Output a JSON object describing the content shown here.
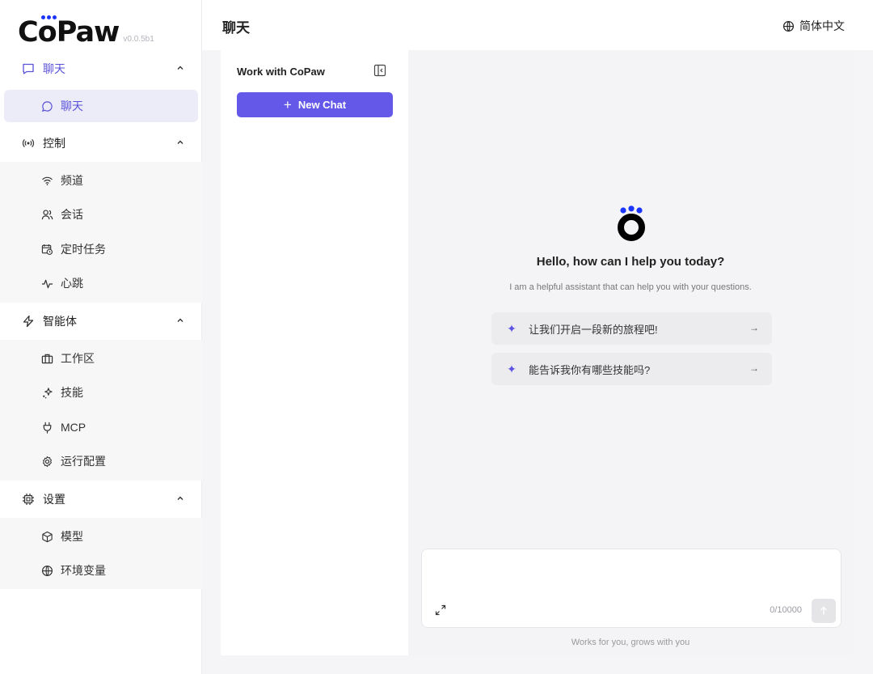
{
  "app": {
    "logo": "CoPaw",
    "version": "v0.0.5b1",
    "accent": "#6358e8",
    "logo_dot_color": "#1a35ff"
  },
  "sidebar": {
    "groups": [
      {
        "label": "聊天",
        "icon": "message-icon",
        "expanded": true,
        "items": [
          {
            "label": "聊天",
            "icon": "chat-bubble-icon",
            "active": true
          }
        ]
      },
      {
        "label": "控制",
        "icon": "broadcast-icon",
        "expanded": true,
        "items": [
          {
            "label": "频道",
            "icon": "wifi-icon"
          },
          {
            "label": "会话",
            "icon": "users-icon"
          },
          {
            "label": "定时任务",
            "icon": "calendar-clock-icon"
          },
          {
            "label": "心跳",
            "icon": "pulse-icon"
          }
        ]
      },
      {
        "label": "智能体",
        "icon": "lightning-icon",
        "expanded": true,
        "items": [
          {
            "label": "工作区",
            "icon": "briefcase-icon"
          },
          {
            "label": "技能",
            "icon": "sparkles-icon"
          },
          {
            "label": "MCP",
            "icon": "plug-icon"
          },
          {
            "label": "运行配置",
            "icon": "gear-icon"
          }
        ]
      },
      {
        "label": "设置",
        "icon": "chip-icon",
        "expanded": true,
        "items": [
          {
            "label": "模型",
            "icon": "cube-icon"
          },
          {
            "label": "环境变量",
            "icon": "globe-icon"
          }
        ]
      }
    ]
  },
  "header": {
    "title": "聊天",
    "language": "简体中文"
  },
  "sessions": {
    "title": "Work with CoPaw",
    "new_chat_label": "New Chat"
  },
  "chat": {
    "greeting": "Hello, how can I help you today?",
    "subtitle": "I am a helpful assistant that can help you with your questions.",
    "prompts": [
      "让我们开启一段新的旅程吧!",
      "能告诉我你有哪些技能吗?"
    ],
    "input_value": "",
    "char_count": "0/10000",
    "footer": "Works for you, grows with you"
  }
}
